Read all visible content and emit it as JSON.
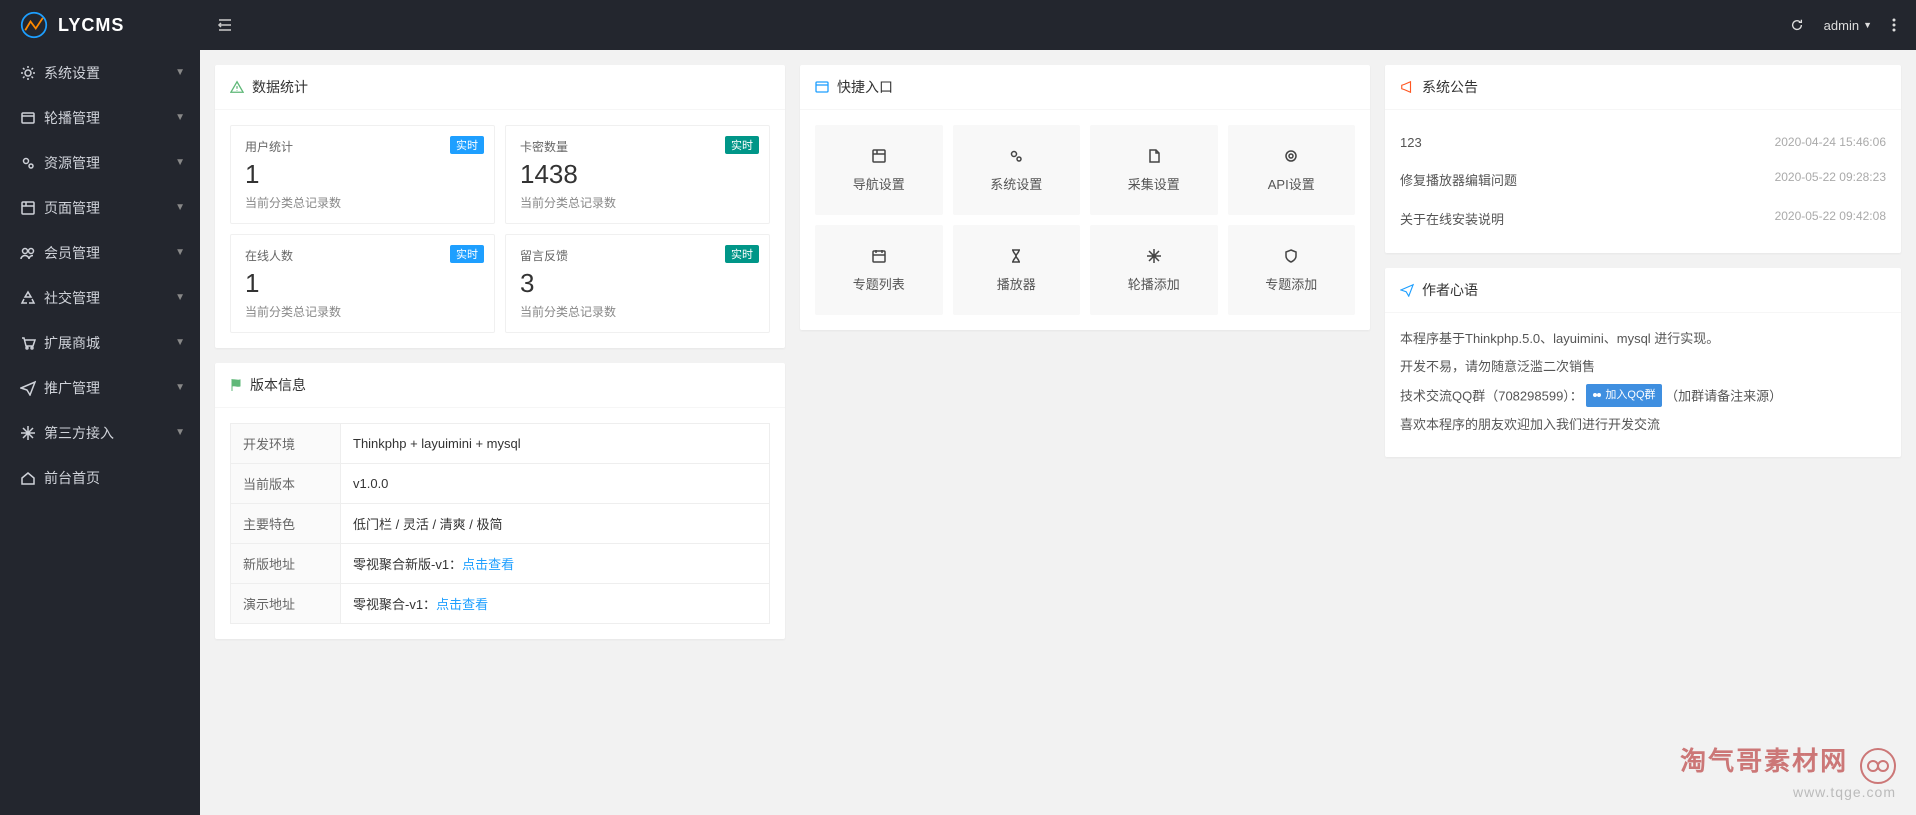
{
  "brand": "LYCMS",
  "header": {
    "user": "admin"
  },
  "sidebar": {
    "items": [
      {
        "label": "系统设置",
        "icon": "gear"
      },
      {
        "label": "轮播管理",
        "icon": "slides"
      },
      {
        "label": "资源管理",
        "icon": "cogs"
      },
      {
        "label": "页面管理",
        "icon": "window"
      },
      {
        "label": "会员管理",
        "icon": "users"
      },
      {
        "label": "社交管理",
        "icon": "recycle"
      },
      {
        "label": "扩展商城",
        "icon": "cart"
      },
      {
        "label": "推广管理",
        "icon": "send"
      },
      {
        "label": "第三方接入",
        "icon": "snow"
      },
      {
        "label": "前台首页",
        "icon": "home"
      }
    ]
  },
  "stats": {
    "title": "数据统计",
    "items": [
      {
        "title": "用户统计",
        "value": "1",
        "sub": "当前分类总记录数",
        "badge": "实时",
        "badgeClass": ""
      },
      {
        "title": "卡密数量",
        "value": "1438",
        "sub": "当前分类总记录数",
        "badge": "实时",
        "badgeClass": "green"
      },
      {
        "title": "在线人数",
        "value": "1",
        "sub": "当前分类总记录数",
        "badge": "实时",
        "badgeClass": ""
      },
      {
        "title": "留言反馈",
        "value": "3",
        "sub": "当前分类总记录数",
        "badge": "实时",
        "badgeClass": "green"
      }
    ]
  },
  "quick": {
    "title": "快捷入口",
    "items": [
      {
        "label": "导航设置",
        "icon": "window"
      },
      {
        "label": "系统设置",
        "icon": "cogs"
      },
      {
        "label": "采集设置",
        "icon": "file"
      },
      {
        "label": "API设置",
        "icon": "target"
      },
      {
        "label": "专题列表",
        "icon": "calendar"
      },
      {
        "label": "播放器",
        "icon": "hourglass"
      },
      {
        "label": "轮播添加",
        "icon": "snow"
      },
      {
        "label": "专题添加",
        "icon": "shield"
      }
    ]
  },
  "announce": {
    "title": "系统公告",
    "items": [
      {
        "text": "123",
        "time": "2020-04-24 15:46:06"
      },
      {
        "text": "修复播放器编辑问题",
        "time": "2020-05-22 09:28:23"
      },
      {
        "text": "关于在线安装说明",
        "time": "2020-05-22 09:42:08"
      }
    ]
  },
  "version": {
    "title": "版本信息",
    "rows": [
      {
        "k": "开发环境",
        "v": "Thinkphp + layuimini + mysql"
      },
      {
        "k": "当前版本",
        "v": "v1.0.0"
      },
      {
        "k": "主要特色",
        "v": "低门栏 / 灵活 / 清爽 / 极简"
      },
      {
        "k": "新版地址",
        "prefix": "零视聚合新版-v1：",
        "link": "点击查看"
      },
      {
        "k": "演示地址",
        "prefix": "零视聚合-v1：",
        "link": "点击查看"
      }
    ]
  },
  "author": {
    "title": "作者心语",
    "line1": "本程序基于Thinkphp.5.0、layuimini、mysql 进行实现。",
    "line2": "开发不易，请勿随意泛滥二次销售",
    "line3a": "技术交流QQ群（708298599）：",
    "qq_badge": "加入QQ群",
    "line3b": "（加群请备注来源）",
    "line4": "喜欢本程序的朋友欢迎加入我们进行开发交流"
  },
  "watermark": {
    "t1": "淘气哥素材网",
    "t2": "www.tqge.com"
  }
}
